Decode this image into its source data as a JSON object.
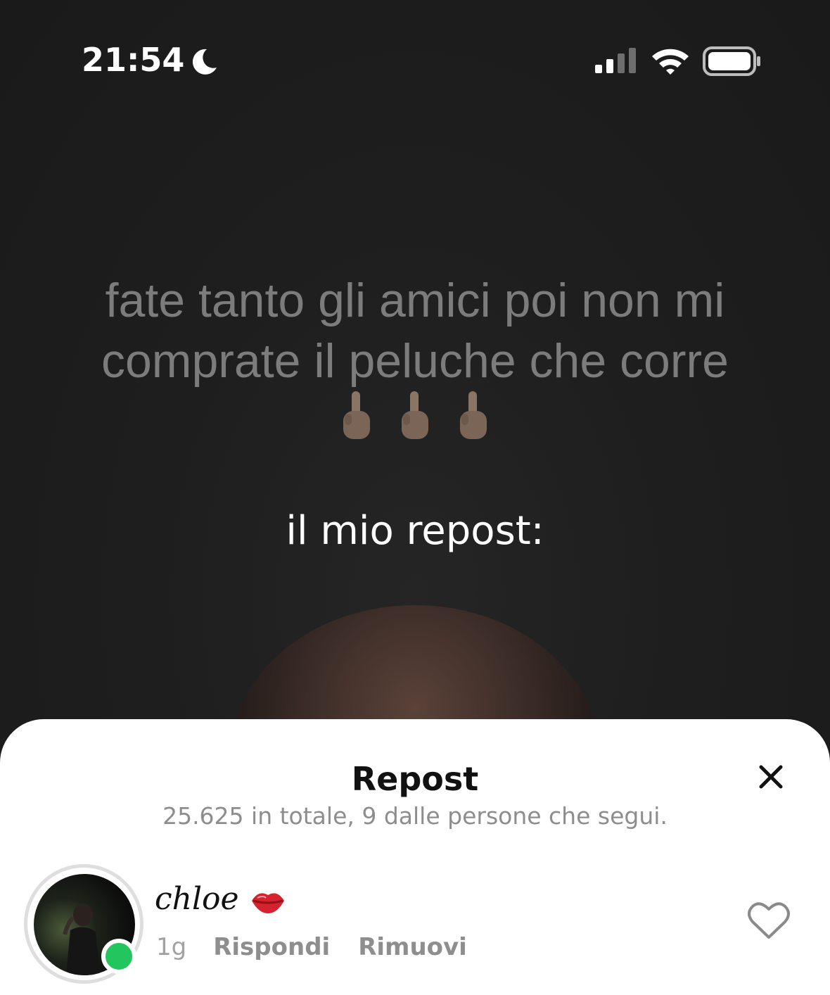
{
  "status_bar": {
    "time": "21:54",
    "icons": [
      "moon-icon",
      "signal-icon",
      "wifi-icon",
      "battery-icon"
    ]
  },
  "video": {
    "caption": "fate tanto gli amici poi non mi comprate il peluche che corre",
    "caption_emoji": "🖕🏼🖕🏼🖕🏼",
    "overlay_text": "il mio repost:"
  },
  "sheet": {
    "title": "Repost",
    "subtitle": "25.625 in totale, 9 dalle persone che segui.",
    "close_icon": "close-icon",
    "item": {
      "username": "cℎloe",
      "username_emoji": "lips-icon",
      "time": "1g",
      "reply_label": "Rispondi",
      "remove_label": "Rimuovi",
      "online": true,
      "like_icon": "heart-icon"
    }
  },
  "colors": {
    "background": "#1c1c1c",
    "online_green": "#22c55e",
    "sheet_bg": "#ffffff",
    "muted_text": "#8e8e8e"
  }
}
